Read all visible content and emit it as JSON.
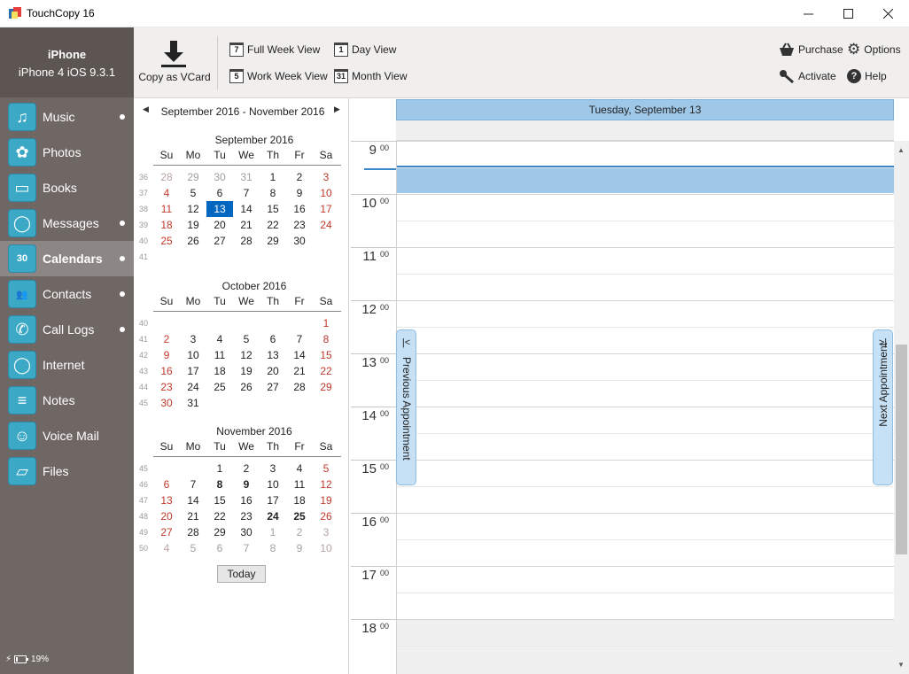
{
  "window": {
    "title": "TouchCopy 16",
    "minimize": "—",
    "maximize": "☐",
    "close": "✕"
  },
  "device": {
    "name": "iPhone",
    "model": "iPhone 4 iOS 9.3.1"
  },
  "nav": [
    {
      "label": "Music",
      "icon": "music-note-icon",
      "glyph": "♫",
      "dot": true,
      "active": false
    },
    {
      "label": "Photos",
      "icon": "flower-icon",
      "glyph": "✿",
      "dot": false,
      "active": false
    },
    {
      "label": "Books",
      "icon": "book-icon",
      "glyph": "▭",
      "dot": false,
      "active": false
    },
    {
      "label": "Messages",
      "icon": "speech-bubble-icon",
      "glyph": "◯",
      "dot": true,
      "active": false
    },
    {
      "label": "Calendars",
      "icon": "calendar-icon",
      "glyph": "30",
      "dot": true,
      "active": true
    },
    {
      "label": "Contacts",
      "icon": "people-icon",
      "glyph": "👥",
      "dot": true,
      "active": false
    },
    {
      "label": "Call Logs",
      "icon": "phone-icon",
      "glyph": "✆",
      "dot": true,
      "active": false
    },
    {
      "label": "Internet",
      "icon": "globe-icon",
      "glyph": "◯",
      "dot": false,
      "active": false
    },
    {
      "label": "Notes",
      "icon": "notepad-icon",
      "glyph": "≡",
      "dot": false,
      "active": false
    },
    {
      "label": "Voice Mail",
      "icon": "voicemail-icon",
      "glyph": "☺",
      "dot": false,
      "active": false
    },
    {
      "label": "Files",
      "icon": "folder-icon",
      "glyph": "▱",
      "dot": false,
      "active": false
    }
  ],
  "battery": {
    "percent": "19%",
    "level": 0.19
  },
  "toolbar": {
    "copy_vcard": "Copy as VCard",
    "full_week": "Full Week View",
    "full_week_num": "7",
    "day_view": "Day View",
    "day_view_num": "1",
    "work_week": "Work Week View",
    "work_week_num": "5",
    "month_view": "Month View",
    "month_view_num": "31",
    "purchase": "Purchase",
    "options": "Options",
    "activate": "Activate",
    "help": "Help"
  },
  "mini_calendar": {
    "range": "September 2016 - November 2016",
    "prev": "◀",
    "next": "▶",
    "dow": [
      "Su",
      "Mo",
      "Tu",
      "We",
      "Th",
      "Fr",
      "Sa"
    ],
    "months": [
      {
        "title": "September 2016",
        "weeks": [
          {
            "num": "36",
            "days": [
              "28",
              "29",
              "30",
              "31",
              "1",
              "2",
              "3"
            ]
          },
          {
            "num": "37",
            "days": [
              "4",
              "5",
              "6",
              "7",
              "8",
              "9",
              "10"
            ]
          },
          {
            "num": "38",
            "days": [
              "11",
              "12",
              "13",
              "14",
              "15",
              "16",
              "17"
            ]
          },
          {
            "num": "39",
            "days": [
              "18",
              "19",
              "20",
              "21",
              "22",
              "23",
              "24"
            ]
          },
          {
            "num": "40",
            "days": [
              "25",
              "26",
              "27",
              "28",
              "29",
              "30",
              ""
            ]
          },
          {
            "num": "41",
            "days": [
              "",
              "",
              "",
              "",
              "",
              "",
              ""
            ]
          }
        ],
        "other_first_row": 4,
        "other_last_row": 0,
        "bold": [],
        "selected": "13"
      },
      {
        "title": "October 2016",
        "weeks": [
          {
            "num": "40",
            "days": [
              "",
              "",
              "",
              "",
              "",
              "",
              "1"
            ]
          },
          {
            "num": "41",
            "days": [
              "2",
              "3",
              "4",
              "5",
              "6",
              "7",
              "8"
            ]
          },
          {
            "num": "42",
            "days": [
              "9",
              "10",
              "11",
              "12",
              "13",
              "14",
              "15"
            ]
          },
          {
            "num": "43",
            "days": [
              "16",
              "17",
              "18",
              "19",
              "20",
              "21",
              "22"
            ]
          },
          {
            "num": "44",
            "days": [
              "23",
              "24",
              "25",
              "26",
              "27",
              "28",
              "29"
            ]
          },
          {
            "num": "45",
            "days": [
              "30",
              "31",
              "",
              "",
              "",
              "",
              ""
            ]
          }
        ],
        "other_first_row": 0,
        "other_last_row": 0,
        "bold": [],
        "selected": ""
      },
      {
        "title": "November 2016",
        "weeks": [
          {
            "num": "45",
            "days": [
              "",
              "",
              "1",
              "2",
              "3",
              "4",
              "5"
            ]
          },
          {
            "num": "46",
            "days": [
              "6",
              "7",
              "8",
              "9",
              "10",
              "11",
              "12"
            ]
          },
          {
            "num": "47",
            "days": [
              "13",
              "14",
              "15",
              "16",
              "17",
              "18",
              "19"
            ]
          },
          {
            "num": "48",
            "days": [
              "20",
              "21",
              "22",
              "23",
              "24",
              "25",
              "26"
            ]
          },
          {
            "num": "49",
            "days": [
              "27",
              "28",
              "29",
              "30",
              "1",
              "2",
              "3"
            ]
          },
          {
            "num": "50",
            "days": [
              "4",
              "5",
              "6",
              "7",
              "8",
              "9",
              "10"
            ]
          }
        ],
        "other_first_row": 0,
        "other_last_row": 10,
        "bold": [
          "8",
          "9",
          "24",
          "25"
        ],
        "selected": ""
      }
    ],
    "today": "Today"
  },
  "day_view": {
    "header": "Tuesday, September 13",
    "hours": [
      "9",
      "10",
      "11",
      "12",
      "13",
      "14",
      "15",
      "16",
      "17",
      "18"
    ],
    "minutes": "00",
    "prev_appt": "Previous Appointment",
    "next_appt": "Next Appointment",
    "prev_sym": "|<",
    "next_sym": ">|"
  },
  "colors": {
    "sidebar": "#6f6764",
    "accent": "#3ba9c6",
    "selected_day": "#0067c0",
    "appointment": "#9ec7e8",
    "weekend": "#c0392b"
  }
}
